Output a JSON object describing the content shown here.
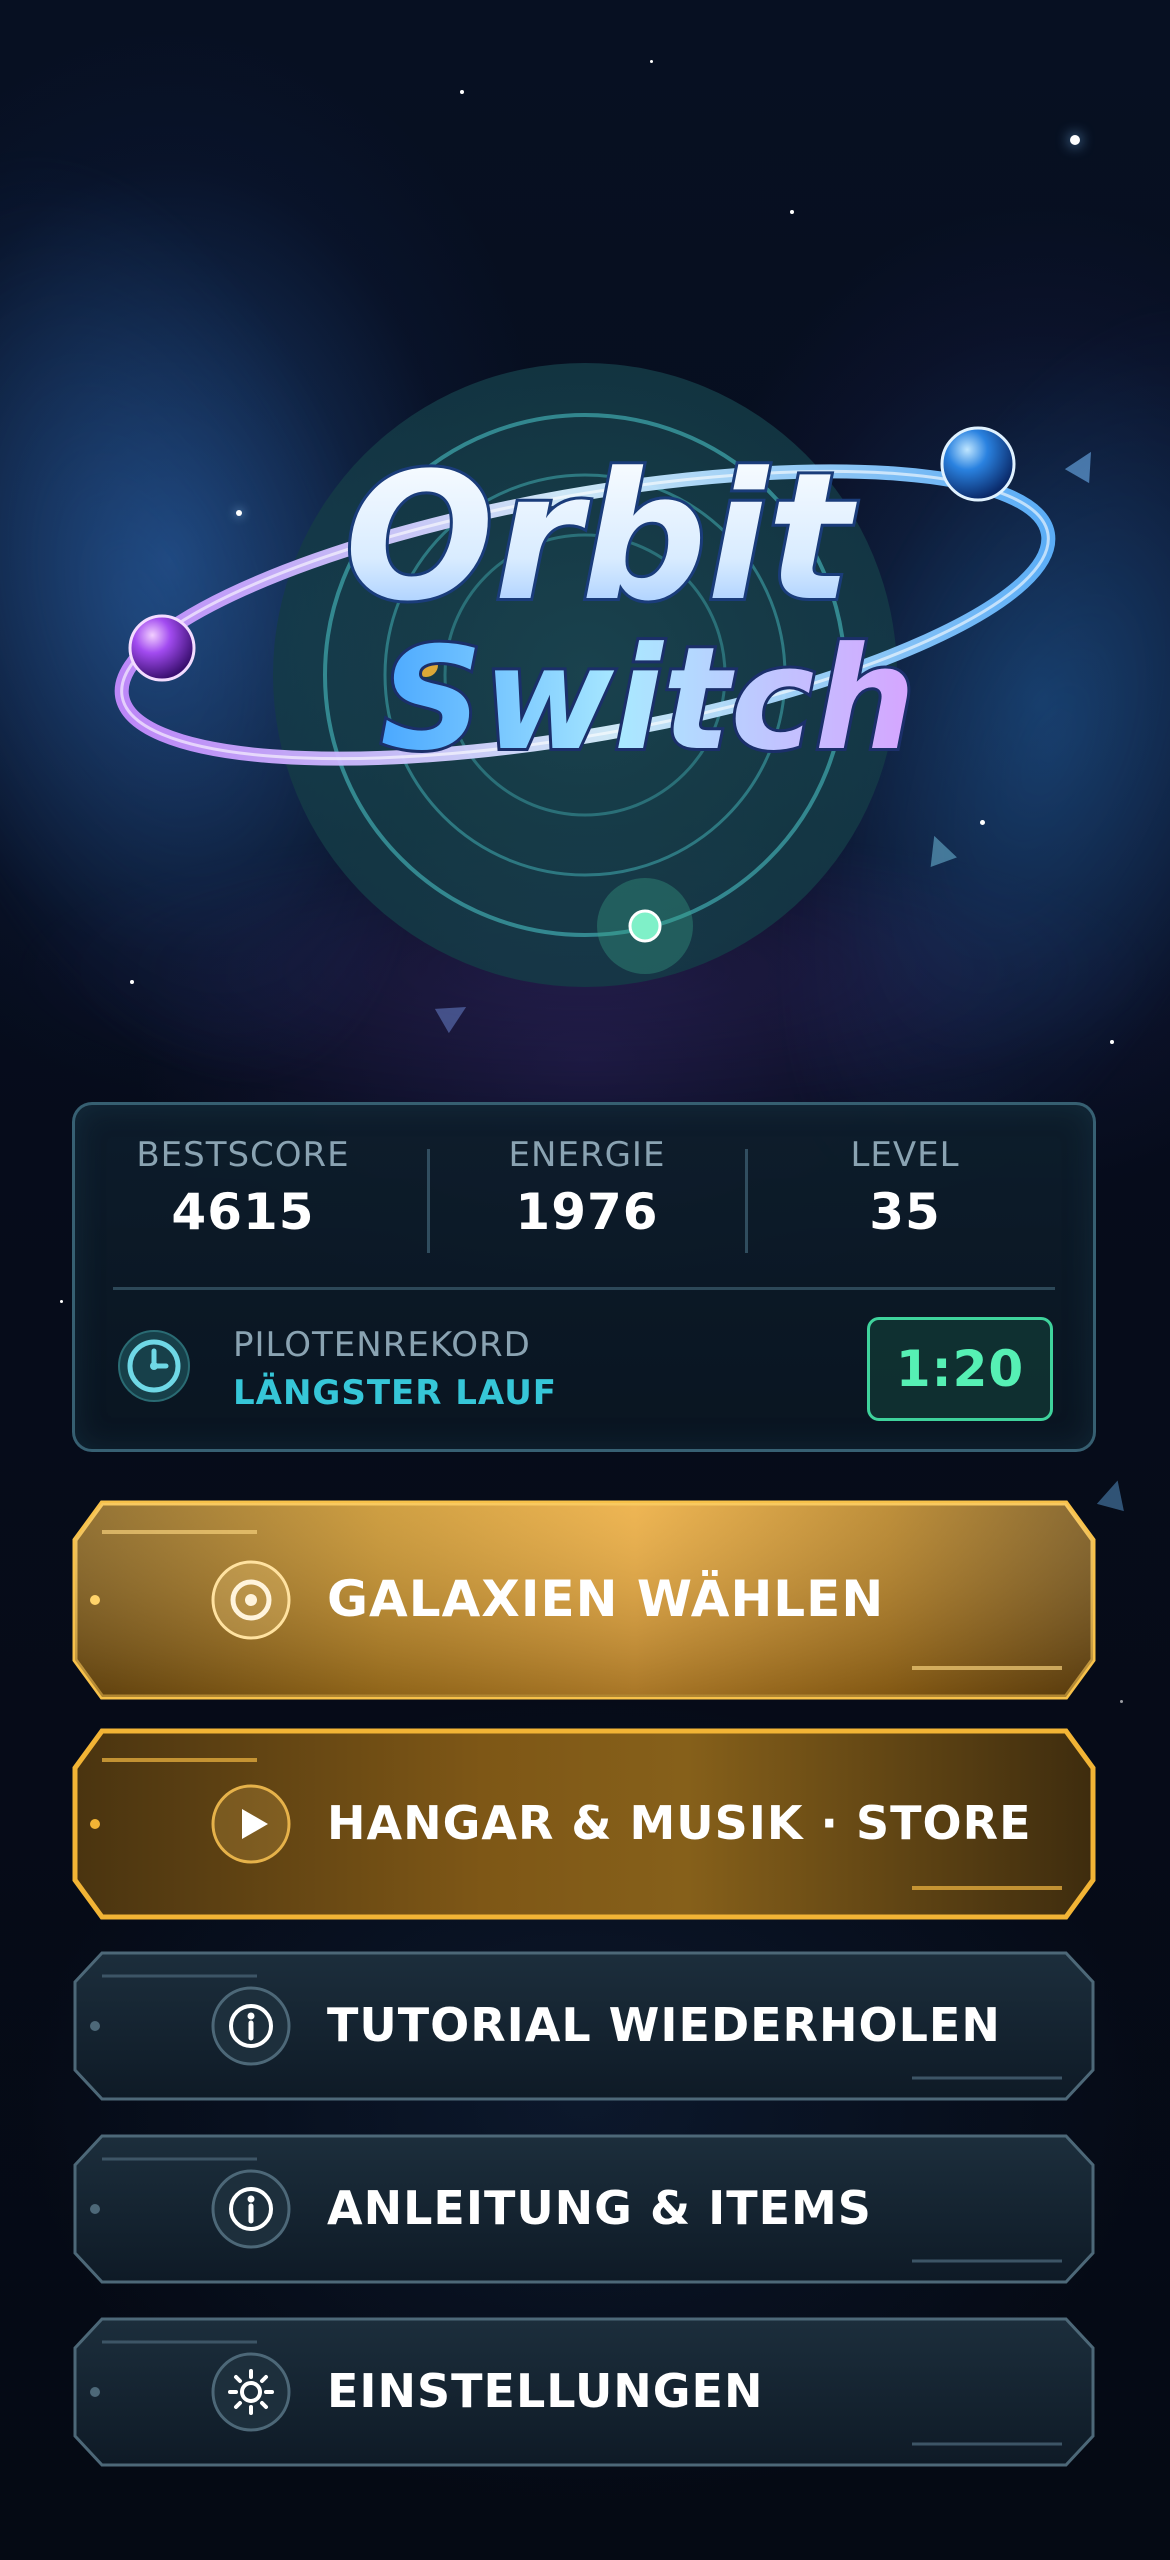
{
  "logo": {
    "line1": "Orbit",
    "line2": "Switch"
  },
  "stats": [
    {
      "label": "BESTSCORE",
      "value": "4615"
    },
    {
      "label": "ENERGIE",
      "value": "1976"
    },
    {
      "label": "LEVEL",
      "value": "35"
    }
  ],
  "record": {
    "icon": "clock-icon",
    "label": "PILOTENREKORD",
    "sublabel": "LÄNGSTER LAUF",
    "time": "1:20"
  },
  "menu": [
    {
      "label": "GALAXIEN WÄHLEN",
      "icon": "target-icon",
      "style": "gold-primary"
    },
    {
      "label": "HANGAR & MUSIK · STORE",
      "icon": "play-icon",
      "style": "gold-secondary"
    },
    {
      "label": "TUTORIAL WIEDERHOLEN",
      "icon": "info-icon",
      "style": "dark"
    },
    {
      "label": "ANLEITUNG & ITEMS",
      "icon": "info-icon",
      "style": "dark"
    },
    {
      "label": "EINSTELLUNGEN",
      "icon": "gear-icon",
      "style": "dark"
    }
  ],
  "colors": {
    "gold": "#f2b435",
    "gold_dark": "#6a4a10",
    "teal": "#36c6d8",
    "green": "#56f0b4",
    "panel_border": "#46788c"
  }
}
